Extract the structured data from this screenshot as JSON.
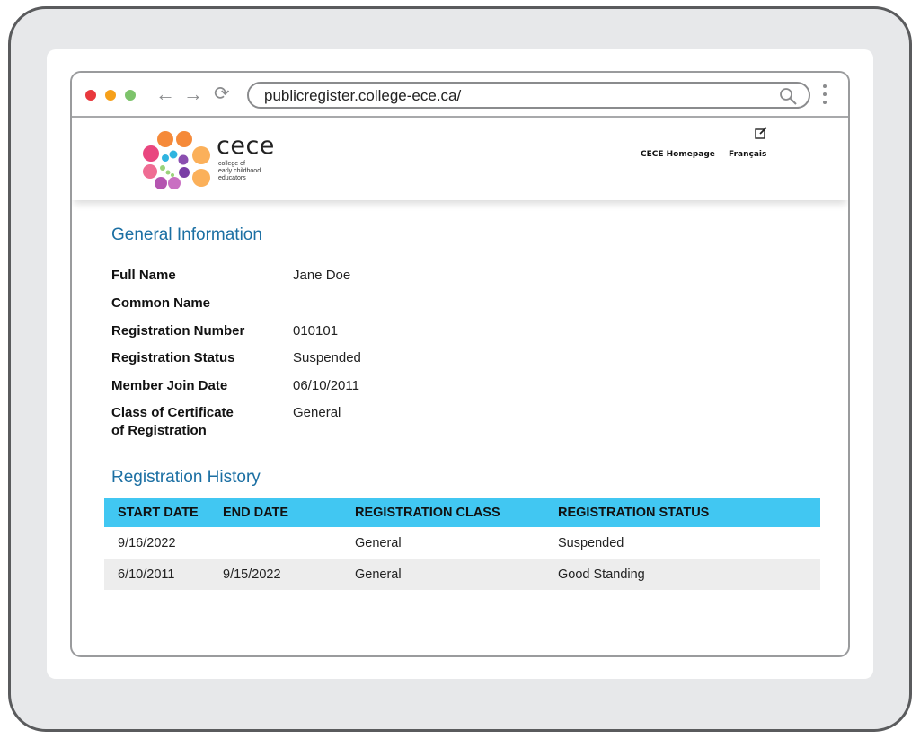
{
  "browser": {
    "url": "publicregister.college-ece.ca/",
    "back_icon": "arrow-left-icon",
    "forward_icon": "arrow-right-icon",
    "reload_icon": "reload-icon",
    "search_icon": "search-icon",
    "menu_icon": "more-vertical-icon",
    "window_controls": [
      "close",
      "minimize",
      "maximize"
    ],
    "colors": {
      "close": "#e8383d",
      "minimize": "#f6a01a",
      "maximize": "#7dc36b"
    }
  },
  "header": {
    "logo": {
      "wordmark": "cece",
      "subtitle_lines": [
        "college of",
        "early childhood",
        "educators"
      ]
    },
    "edit_icon": "edit-icon",
    "links": [
      "CECE Homepage",
      "Français"
    ]
  },
  "general_information": {
    "title": "General Information",
    "fields": [
      {
        "label": "Full Name",
        "value": "Jane Doe"
      },
      {
        "label": "Common Name",
        "value": ""
      },
      {
        "label": "Registration Number",
        "value": "010101"
      },
      {
        "label": "Registration Status",
        "value": "Suspended"
      },
      {
        "label": "Member Join Date",
        "value": "06/10/2011"
      },
      {
        "label_lines": [
          "Class of Certificate",
          "of Registration"
        ],
        "value": "General"
      }
    ]
  },
  "registration_history": {
    "title": "Registration History",
    "header_color": "#41c7f2",
    "columns": [
      "START DATE",
      "END DATE",
      "REGISTRATION CLASS",
      "REGISTRATION STATUS"
    ],
    "rows": [
      [
        "9/16/2022",
        "",
        "General",
        "Suspended"
      ],
      [
        "6/10/2011",
        "9/15/2022",
        "General",
        "Good Standing"
      ]
    ]
  }
}
